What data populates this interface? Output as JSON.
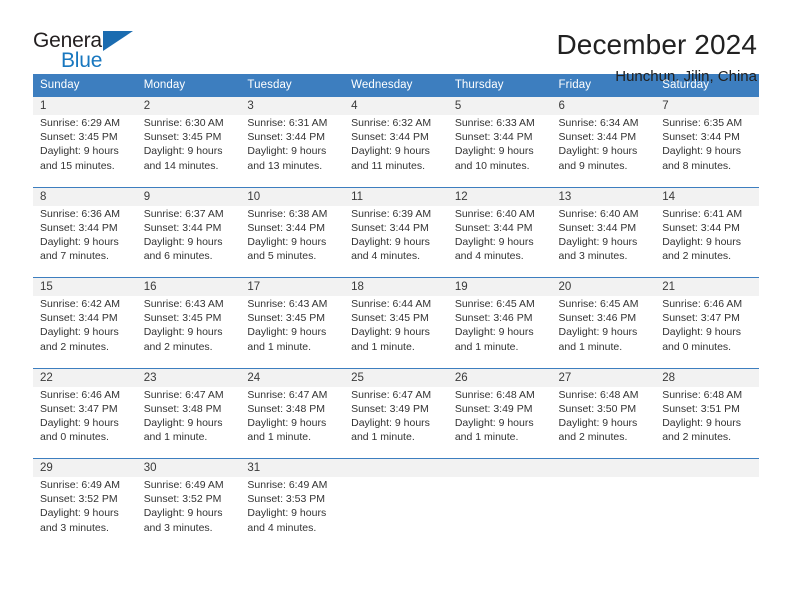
{
  "logo": {
    "word_one": "General",
    "word_two": "Blue",
    "mark": "triangle-icon"
  },
  "header": {
    "month_title": "December 2024",
    "location": "Hunchun, Jilin, China"
  },
  "calendar": {
    "weekday_headers": [
      "Sunday",
      "Monday",
      "Tuesday",
      "Wednesday",
      "Thursday",
      "Friday",
      "Saturday"
    ],
    "accent_color": "#3d7ebf",
    "daynum_bg": "#f2f2f2",
    "weeks": [
      [
        {
          "day": "1",
          "sunrise": "Sunrise: 6:29 AM",
          "sunset": "Sunset: 3:45 PM",
          "daylight": "Daylight: 9 hours and 15 minutes."
        },
        {
          "day": "2",
          "sunrise": "Sunrise: 6:30 AM",
          "sunset": "Sunset: 3:45 PM",
          "daylight": "Daylight: 9 hours and 14 minutes."
        },
        {
          "day": "3",
          "sunrise": "Sunrise: 6:31 AM",
          "sunset": "Sunset: 3:44 PM",
          "daylight": "Daylight: 9 hours and 13 minutes."
        },
        {
          "day": "4",
          "sunrise": "Sunrise: 6:32 AM",
          "sunset": "Sunset: 3:44 PM",
          "daylight": "Daylight: 9 hours and 11 minutes."
        },
        {
          "day": "5",
          "sunrise": "Sunrise: 6:33 AM",
          "sunset": "Sunset: 3:44 PM",
          "daylight": "Daylight: 9 hours and 10 minutes."
        },
        {
          "day": "6",
          "sunrise": "Sunrise: 6:34 AM",
          "sunset": "Sunset: 3:44 PM",
          "daylight": "Daylight: 9 hours and 9 minutes."
        },
        {
          "day": "7",
          "sunrise": "Sunrise: 6:35 AM",
          "sunset": "Sunset: 3:44 PM",
          "daylight": "Daylight: 9 hours and 8 minutes."
        }
      ],
      [
        {
          "day": "8",
          "sunrise": "Sunrise: 6:36 AM",
          "sunset": "Sunset: 3:44 PM",
          "daylight": "Daylight: 9 hours and 7 minutes."
        },
        {
          "day": "9",
          "sunrise": "Sunrise: 6:37 AM",
          "sunset": "Sunset: 3:44 PM",
          "daylight": "Daylight: 9 hours and 6 minutes."
        },
        {
          "day": "10",
          "sunrise": "Sunrise: 6:38 AM",
          "sunset": "Sunset: 3:44 PM",
          "daylight": "Daylight: 9 hours and 5 minutes."
        },
        {
          "day": "11",
          "sunrise": "Sunrise: 6:39 AM",
          "sunset": "Sunset: 3:44 PM",
          "daylight": "Daylight: 9 hours and 4 minutes."
        },
        {
          "day": "12",
          "sunrise": "Sunrise: 6:40 AM",
          "sunset": "Sunset: 3:44 PM",
          "daylight": "Daylight: 9 hours and 4 minutes."
        },
        {
          "day": "13",
          "sunrise": "Sunrise: 6:40 AM",
          "sunset": "Sunset: 3:44 PM",
          "daylight": "Daylight: 9 hours and 3 minutes."
        },
        {
          "day": "14",
          "sunrise": "Sunrise: 6:41 AM",
          "sunset": "Sunset: 3:44 PM",
          "daylight": "Daylight: 9 hours and 2 minutes."
        }
      ],
      [
        {
          "day": "15",
          "sunrise": "Sunrise: 6:42 AM",
          "sunset": "Sunset: 3:44 PM",
          "daylight": "Daylight: 9 hours and 2 minutes."
        },
        {
          "day": "16",
          "sunrise": "Sunrise: 6:43 AM",
          "sunset": "Sunset: 3:45 PM",
          "daylight": "Daylight: 9 hours and 2 minutes."
        },
        {
          "day": "17",
          "sunrise": "Sunrise: 6:43 AM",
          "sunset": "Sunset: 3:45 PM",
          "daylight": "Daylight: 9 hours and 1 minute."
        },
        {
          "day": "18",
          "sunrise": "Sunrise: 6:44 AM",
          "sunset": "Sunset: 3:45 PM",
          "daylight": "Daylight: 9 hours and 1 minute."
        },
        {
          "day": "19",
          "sunrise": "Sunrise: 6:45 AM",
          "sunset": "Sunset: 3:46 PM",
          "daylight": "Daylight: 9 hours and 1 minute."
        },
        {
          "day": "20",
          "sunrise": "Sunrise: 6:45 AM",
          "sunset": "Sunset: 3:46 PM",
          "daylight": "Daylight: 9 hours and 1 minute."
        },
        {
          "day": "21",
          "sunrise": "Sunrise: 6:46 AM",
          "sunset": "Sunset: 3:47 PM",
          "daylight": "Daylight: 9 hours and 0 minutes."
        }
      ],
      [
        {
          "day": "22",
          "sunrise": "Sunrise: 6:46 AM",
          "sunset": "Sunset: 3:47 PM",
          "daylight": "Daylight: 9 hours and 0 minutes."
        },
        {
          "day": "23",
          "sunrise": "Sunrise: 6:47 AM",
          "sunset": "Sunset: 3:48 PM",
          "daylight": "Daylight: 9 hours and 1 minute."
        },
        {
          "day": "24",
          "sunrise": "Sunrise: 6:47 AM",
          "sunset": "Sunset: 3:48 PM",
          "daylight": "Daylight: 9 hours and 1 minute."
        },
        {
          "day": "25",
          "sunrise": "Sunrise: 6:47 AM",
          "sunset": "Sunset: 3:49 PM",
          "daylight": "Daylight: 9 hours and 1 minute."
        },
        {
          "day": "26",
          "sunrise": "Sunrise: 6:48 AM",
          "sunset": "Sunset: 3:49 PM",
          "daylight": "Daylight: 9 hours and 1 minute."
        },
        {
          "day": "27",
          "sunrise": "Sunrise: 6:48 AM",
          "sunset": "Sunset: 3:50 PM",
          "daylight": "Daylight: 9 hours and 2 minutes."
        },
        {
          "day": "28",
          "sunrise": "Sunrise: 6:48 AM",
          "sunset": "Sunset: 3:51 PM",
          "daylight": "Daylight: 9 hours and 2 minutes."
        }
      ],
      [
        {
          "day": "29",
          "sunrise": "Sunrise: 6:49 AM",
          "sunset": "Sunset: 3:52 PM",
          "daylight": "Daylight: 9 hours and 3 minutes."
        },
        {
          "day": "30",
          "sunrise": "Sunrise: 6:49 AM",
          "sunset": "Sunset: 3:52 PM",
          "daylight": "Daylight: 9 hours and 3 minutes."
        },
        {
          "day": "31",
          "sunrise": "Sunrise: 6:49 AM",
          "sunset": "Sunset: 3:53 PM",
          "daylight": "Daylight: 9 hours and 4 minutes."
        },
        {
          "day": "",
          "sunrise": "",
          "sunset": "",
          "daylight": ""
        },
        {
          "day": "",
          "sunrise": "",
          "sunset": "",
          "daylight": ""
        },
        {
          "day": "",
          "sunrise": "",
          "sunset": "",
          "daylight": ""
        },
        {
          "day": "",
          "sunrise": "",
          "sunset": "",
          "daylight": ""
        }
      ]
    ]
  }
}
